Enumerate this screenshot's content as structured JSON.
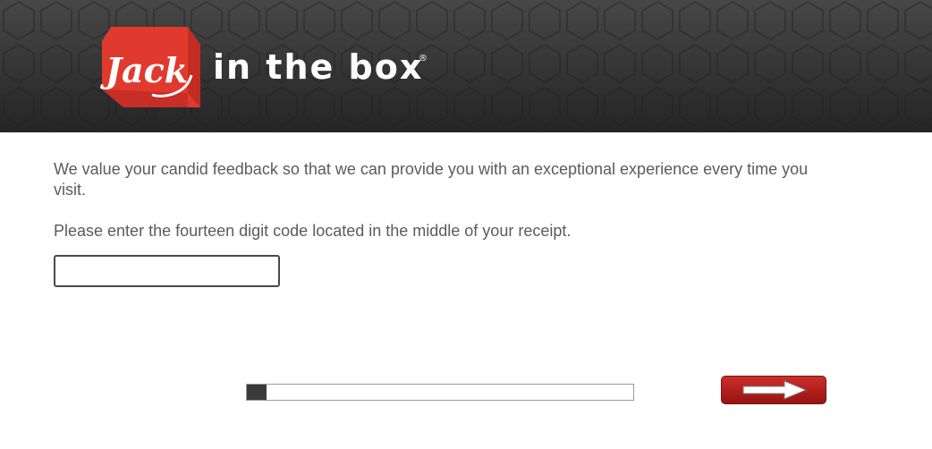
{
  "brand": {
    "logo_mark_text": "Jack",
    "logo_wordmark": "in the box",
    "registered_mark": "®",
    "brand_color": "#e03a2e"
  },
  "survey": {
    "intro_text": "We value your candid feedback so that we can provide you with an exceptional experience every time you visit.",
    "instruction_text": "Please enter the fourteen digit code located in the middle of your receipt.",
    "code_input_value": "",
    "code_input_placeholder": ""
  },
  "progress": {
    "fraction": 0.05
  },
  "navigation": {
    "next_icon": "right-arrow-icon",
    "next_color": "#b41f1d"
  }
}
